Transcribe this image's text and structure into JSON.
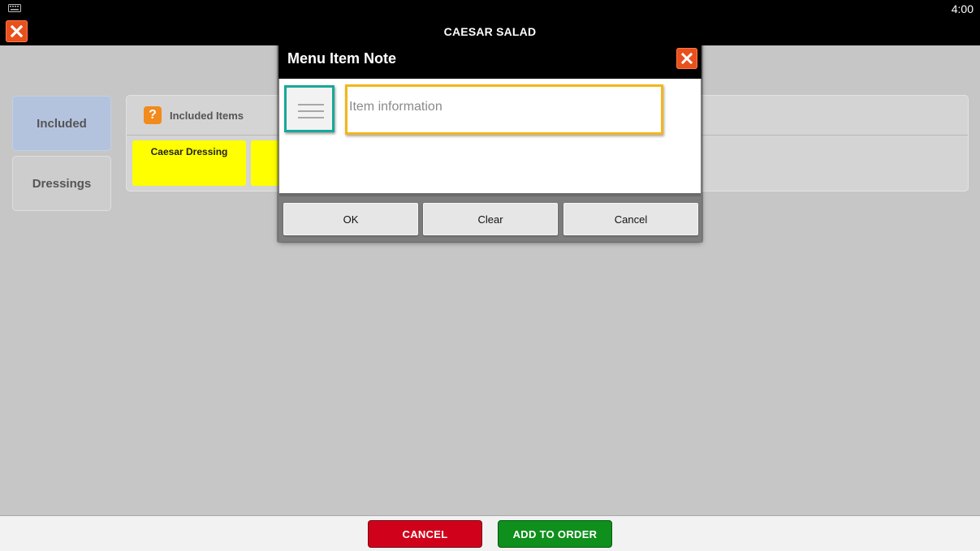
{
  "status_bar": {
    "time": "4:00",
    "keyboard_icon": "keyboard-icon"
  },
  "title_bar": {
    "title": "CAESAR SALAD",
    "close_icon": "close-icon",
    "close_color": "#e8501c"
  },
  "sidebar": {
    "tabs": [
      {
        "label": "Included",
        "selected": true
      },
      {
        "label": "Dressings",
        "selected": false
      }
    ]
  },
  "included_panel": {
    "title": "Included Items",
    "help_icon": "help-icon",
    "help_glyph": "?",
    "items": [
      {
        "label": "Caesar Dressing",
        "color": "#ffff00"
      },
      {
        "label": "",
        "color": "#ffff00"
      }
    ]
  },
  "modal": {
    "title": "Menu Item Note",
    "close_icon": "close-icon",
    "note_list_icon": "list-icon",
    "input_placeholder": "Item information",
    "input_value": "",
    "buttons": {
      "ok": "OK",
      "clear": "Clear",
      "cancel": "Cancel"
    }
  },
  "bottom_bar": {
    "cancel_label": "CANCEL",
    "cancel_color": "#d0021b",
    "add_label": "ADD TO ORDER",
    "add_color": "#0f8f1c"
  }
}
